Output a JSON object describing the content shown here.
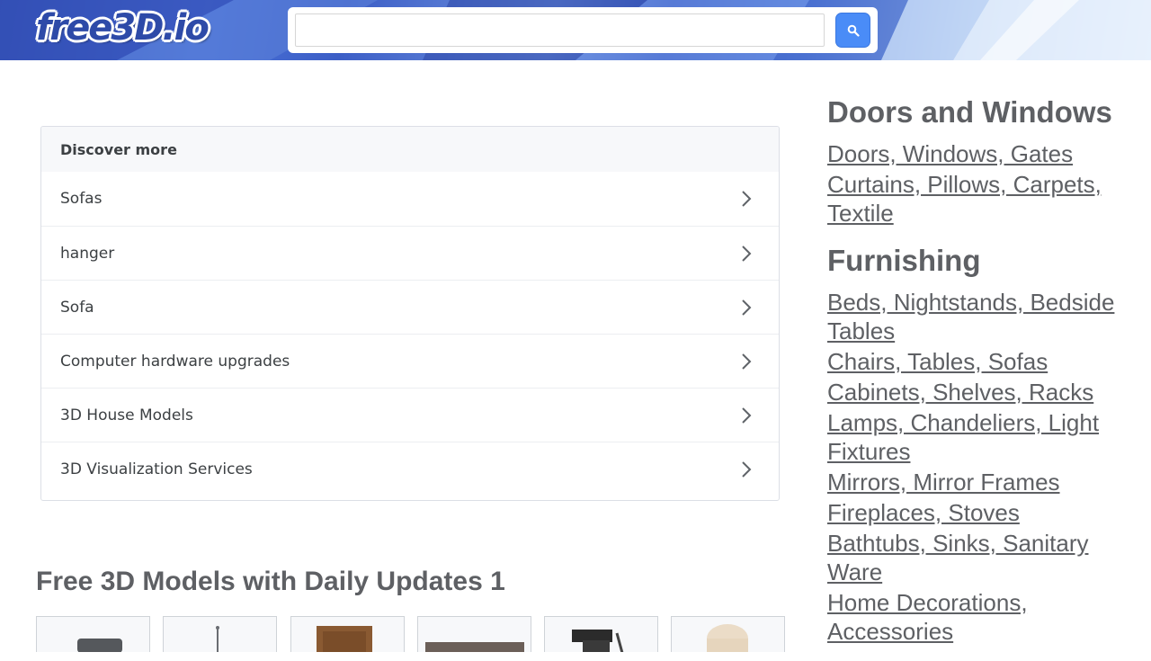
{
  "header": {
    "logo_text": "free3D.io",
    "search": {
      "value": "",
      "placeholder": ""
    },
    "search_button_icon": "search-icon"
  },
  "discover": {
    "title": "Discover more",
    "items": [
      {
        "label": "Sofas"
      },
      {
        "label": "hanger"
      },
      {
        "label": "Sofa"
      },
      {
        "label": "Computer hardware upgrades"
      },
      {
        "label": "3D House Models"
      },
      {
        "label": "3D Visualization Services"
      }
    ],
    "item_icon": "chevron-right-icon"
  },
  "main": {
    "section_title": "Free 3D Models with Daily Updates 1"
  },
  "sidebar": {
    "categories": [
      {
        "title": "Doors and Windows",
        "links": [
          "Doors, Windows, Gates",
          "Curtains, Pillows, Carpets, Textile"
        ]
      },
      {
        "title": "Furnishing",
        "links": [
          "Beds, Nightstands, Bedside Tables",
          "Chairs, Tables, Sofas",
          "Cabinets, Shelves, Racks",
          "Lamps, Chandeliers, Light Fixtures",
          "Mirrors, Mirror Frames",
          "Fireplaces, Stoves",
          "Bathtubs, Sinks, Sanitary Ware",
          "Home Decorations, Accessories"
        ]
      }
    ]
  },
  "colors": {
    "header_blue": "#3c5ec6",
    "search_button": "#4a8cf7",
    "text_gray": "#5e6064",
    "discover_text": "#3c4043"
  }
}
